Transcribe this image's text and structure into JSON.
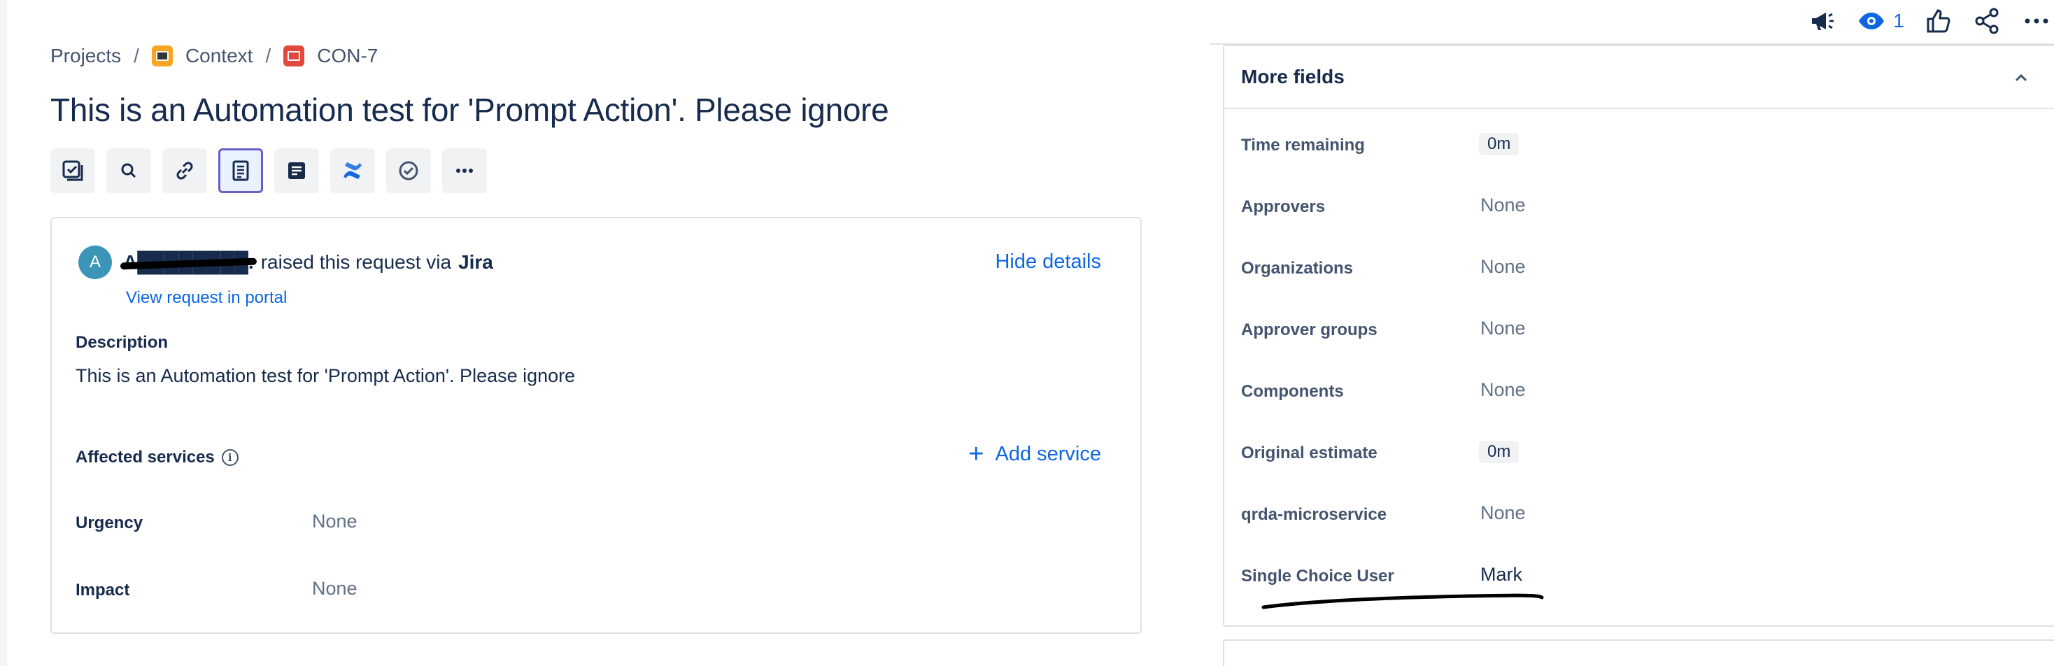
{
  "breadcrumb": {
    "projects": "Projects",
    "separator": "/",
    "project": "Context",
    "issue_key": "CON-7"
  },
  "issue": {
    "title": "This is an Automation test for 'Prompt Action'. Please ignore"
  },
  "toolbar": {
    "icons": [
      "checklist-icon",
      "search-icon",
      "link-icon",
      "document-icon",
      "note-icon",
      "confluence-icon",
      "check-circle-icon",
      "more-icon"
    ]
  },
  "request": {
    "avatar_initial": "A",
    "requester_name": "A████████.",
    "raised_text": "raised this request via",
    "channel": "Jira",
    "view_portal": "View request in portal",
    "hide_details": "Hide details",
    "description_label": "Description",
    "description_text": "This is an Automation test for 'Prompt Action'. Please ignore",
    "affected_services_label": "Affected services",
    "add_service": "Add service",
    "urgency_label": "Urgency",
    "urgency_value": "None",
    "impact_label": "Impact",
    "impact_value": "None"
  },
  "top_actions": {
    "watch_count": "1"
  },
  "more_fields": {
    "title": "More fields",
    "fields": [
      {
        "label": "Time remaining",
        "value": "0m"
      },
      {
        "label": "Approvers",
        "value": "None"
      },
      {
        "label": "Organizations",
        "value": "None"
      },
      {
        "label": "Approver groups",
        "value": "None"
      },
      {
        "label": "Components",
        "value": "None"
      },
      {
        "label": "Original estimate",
        "value": "0m"
      },
      {
        "label": "qrda-microservice",
        "value": "None"
      },
      {
        "label": "Single Choice User",
        "value": "Mark"
      }
    ]
  },
  "colors": {
    "link": "#0c66e4",
    "text": "#172b4d",
    "subtle": "#626f86",
    "border": "#dfe1e6",
    "active_outline": "#6e5dc6"
  }
}
